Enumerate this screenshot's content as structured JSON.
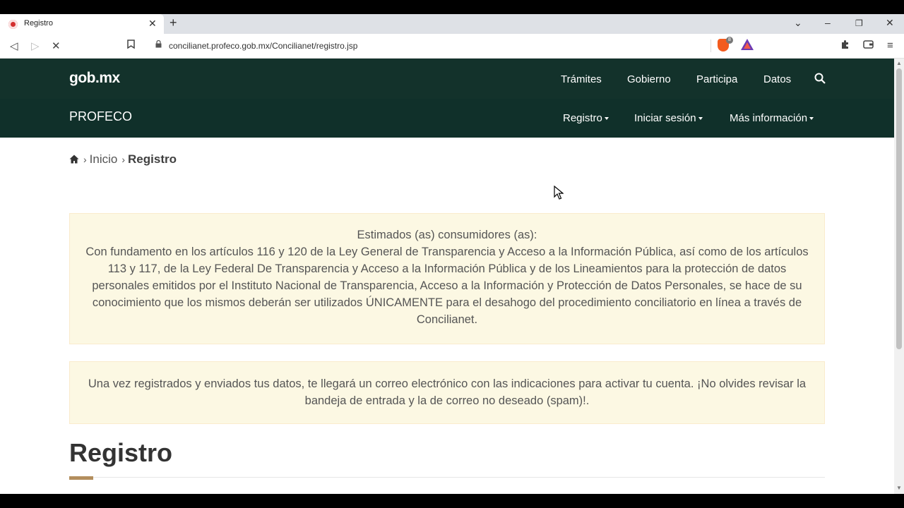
{
  "browser": {
    "tab_title": "Registro",
    "url": "concilianet.profeco.gob.mx/Concilianet/registro.jsp",
    "brave_badge": "8"
  },
  "header": {
    "logo": "gob.mx",
    "nav": [
      "Trámites",
      "Gobierno",
      "Participa",
      "Datos"
    ]
  },
  "subheader": {
    "name": "PROFECO",
    "menu": [
      "Registro",
      "Iniciar sesión",
      "Más información"
    ]
  },
  "breadcrumb": {
    "items": [
      "Inicio",
      "Registro"
    ]
  },
  "notice1": {
    "greeting": "Estimados (as) consumidores (as):",
    "body": "Con fundamento en los artículos 116 y 120 de la Ley General de Transparencia y Acceso a la Información Pública, así como de los artículos 113 y 117, de la Ley Federal De Transparencia y Acceso a la Información Pública y de los Lineamientos para la protección de datos personales emitidos por el Instituto Nacional de Transparencia, Acceso a la Información y Protección de Datos Personales, se hace de su conocimiento que los mismos deberán ser utilizados ÚNICAMENTE para el desahogo del procedimiento conciliatorio en línea a través de Concilianet."
  },
  "notice2": {
    "body": "Una vez registrados y enviados tus datos, te llegará un correo electrónico con las indicaciones para activar tu cuenta. ¡No olvides revisar la bandeja de entrada y la de correo no deseado (spam)!."
  },
  "page_heading": "Registro",
  "colors": {
    "gob_bar": "#13322b",
    "accent": "#b38e5d",
    "alert_bg": "#fcf8e3"
  }
}
